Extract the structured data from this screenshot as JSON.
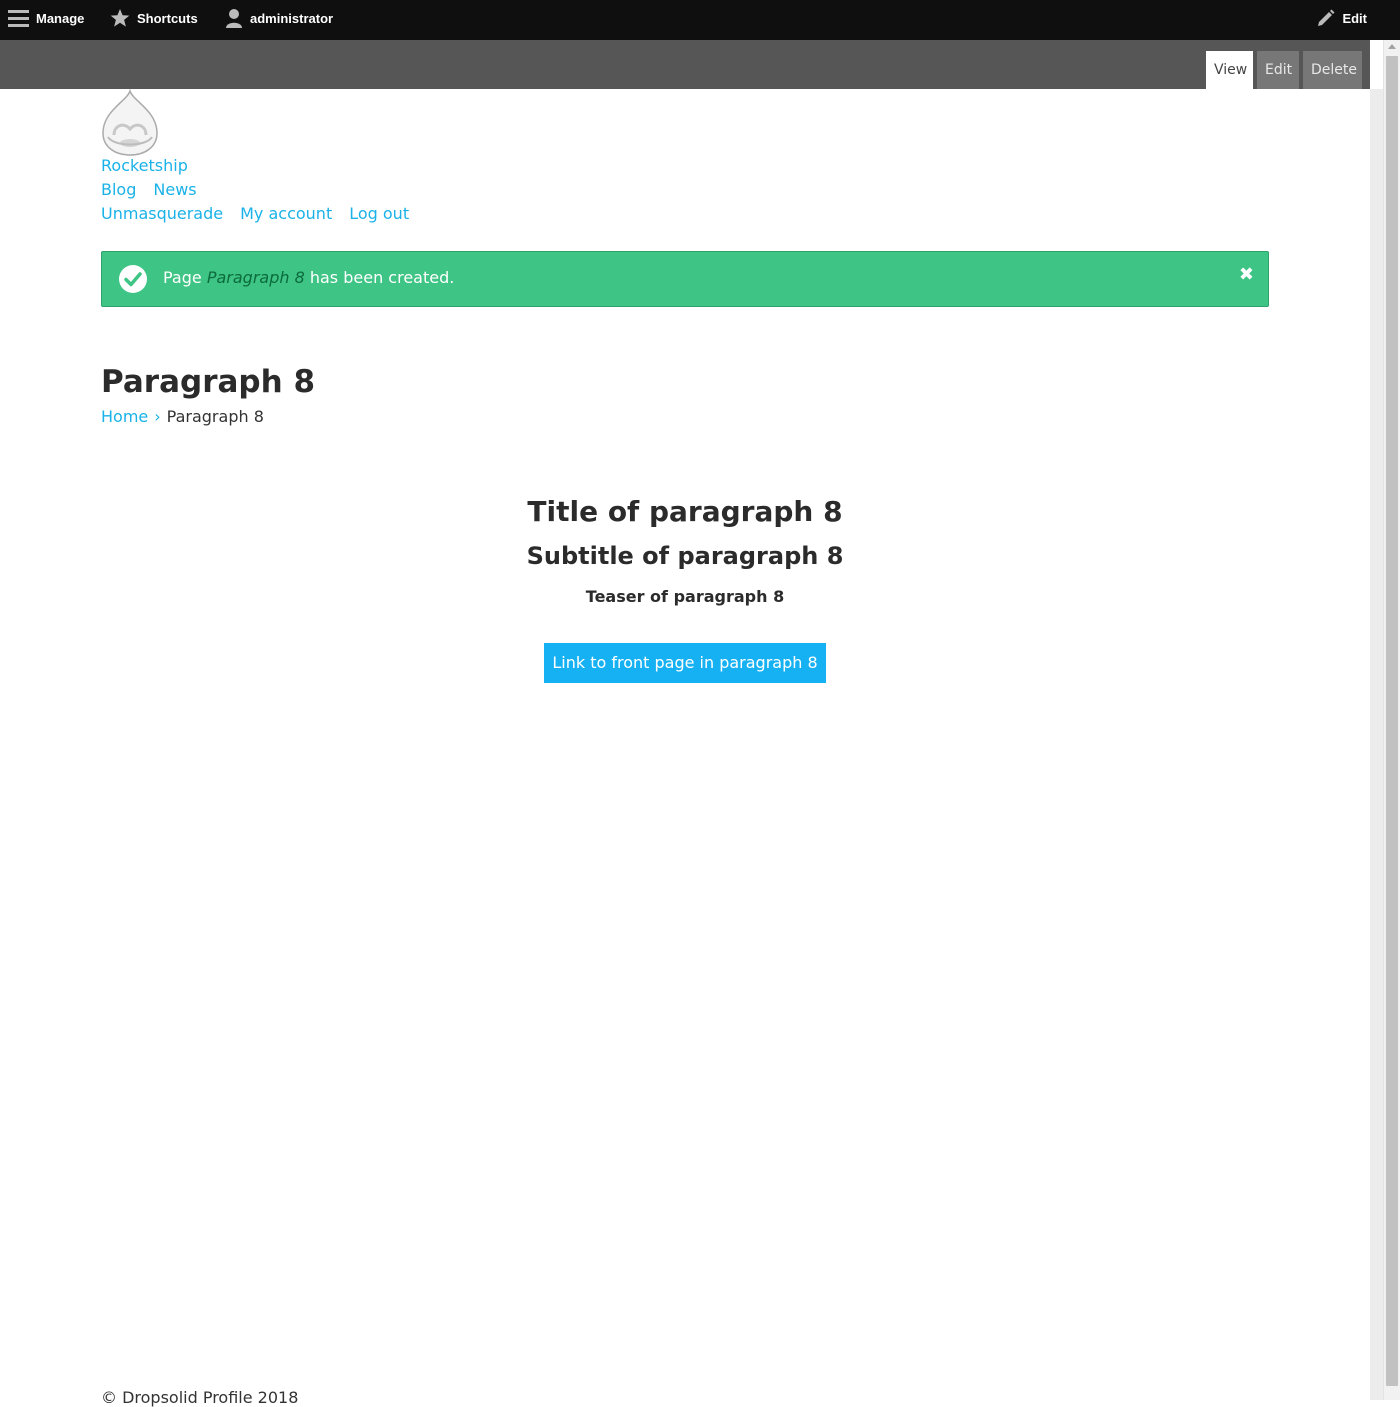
{
  "toolbar": {
    "manage_label": "Manage",
    "shortcuts_label": "Shortcuts",
    "user_label": "administrator",
    "edit_label": "Edit"
  },
  "tabs": {
    "view": "View",
    "edit": "Edit",
    "delete": "Delete"
  },
  "site": {
    "name": "Rocketship",
    "main_menu": [
      "Blog",
      "News"
    ],
    "account_menu": [
      "Unmasquerade",
      "My account",
      "Log out"
    ]
  },
  "message": {
    "prefix": "Page ",
    "emphasis": "Paragraph 8",
    "suffix": " has been created.",
    "close_glyph": "✖"
  },
  "page": {
    "title": "Paragraph 8",
    "breadcrumb": {
      "home": "Home",
      "separator": "›",
      "current": "Paragraph 8"
    }
  },
  "paragraph": {
    "title": "Title of paragraph 8",
    "subtitle": "Subtitle of paragraph 8",
    "teaser": "Teaser of paragraph 8",
    "button_label": "Link to front page in paragraph 8"
  },
  "footer": {
    "text": "© Dropsolid Profile 2018"
  },
  "colors": {
    "link": "#1ab2e8",
    "status_success": "#3ec484",
    "button": "#16b1f3",
    "toolbar": "#0f0f0f",
    "tabs_bar": "#565656"
  },
  "icons": [
    "hamburger-icon",
    "star-icon",
    "user-icon",
    "pencil-icon",
    "drupal-logo",
    "check-circle-icon",
    "close-icon"
  ]
}
